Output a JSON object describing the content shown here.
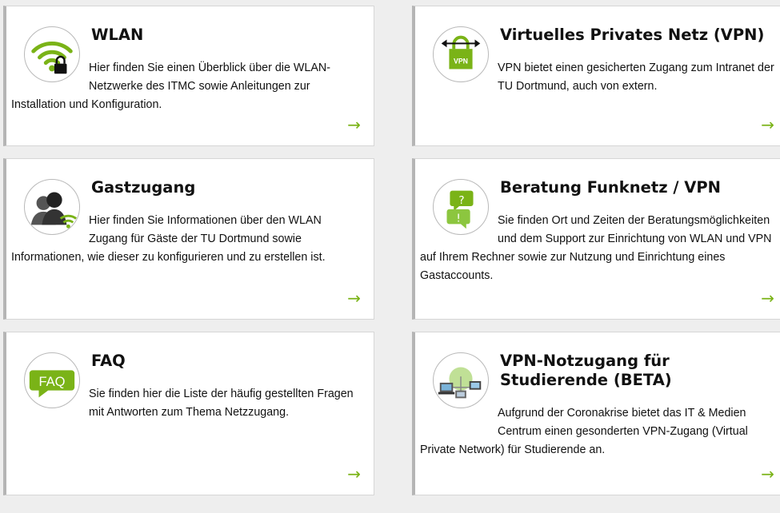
{
  "cards": [
    {
      "title": "WLAN",
      "description": "Hier finden Sie einen Überblick über die WLAN-Netzwerke des ITMC sowie Anleitungen zur Installation und Konfiguration.",
      "icon": "wifi-lock-icon"
    },
    {
      "title": "Virtuelles Privates Netz (VPN)",
      "description": "VPN bietet einen gesicherten Zugang zum Intranet der TU Dortmund, auch von extern.",
      "icon": "vpn-icon",
      "icon_label": "VPN"
    },
    {
      "title": "Gastzugang",
      "description": "Hier finden Sie Informationen über den WLAN Zugang für Gäste der TU Dortmund sowie Informationen, wie dieser zu konfigurieren und zu erstellen ist.",
      "icon": "guest-users-icon"
    },
    {
      "title": "Beratung Funknetz / VPN",
      "description": "Sie finden Ort und Zeiten der Beratungsmöglichkeiten und dem Support zur Einrichtung von WLAN und VPN auf Ihrem Rechner sowie zur Nutzung und Einrichtung eines Gastaccounts.",
      "icon": "question-exclamation-bubbles-icon"
    },
    {
      "title": "FAQ",
      "description": "Sie finden hier die Liste der häufig gestellten Fragen mit Antworten zum Thema Netzzugang.",
      "icon": "faq-bubble-icon",
      "icon_label": "FAQ"
    },
    {
      "title": "VPN-Notzugang für Studierende (BETA)",
      "description": "Aufgrund der Coronakrise bietet das IT & Medien Centrum einen gesonderten VPN-Zugang (Virtual Private Network) für Studierende an.",
      "icon": "network-devices-icon"
    }
  ],
  "arrow_glyph": "→",
  "colors": {
    "accent": "#7ab317",
    "card_border": "#d6d6d6",
    "card_left_border": "#b5b5b5",
    "background": "#eeeeee"
  }
}
